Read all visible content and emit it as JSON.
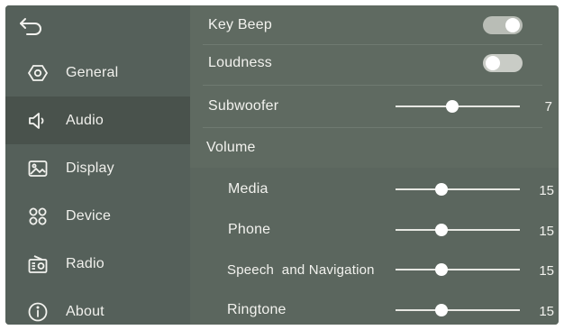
{
  "sidebar": {
    "back_icon": "back-arrow-icon",
    "items": [
      {
        "label": "General",
        "icon": "general-icon",
        "active": false
      },
      {
        "label": "Audio",
        "icon": "speaker-icon",
        "active": true
      },
      {
        "label": "Display",
        "icon": "picture-icon",
        "active": false
      },
      {
        "label": "Device",
        "icon": "device-icon",
        "active": false
      },
      {
        "label": "Radio",
        "icon": "radio-icon",
        "active": false
      },
      {
        "label": "About",
        "icon": "info-icon",
        "active": false
      }
    ]
  },
  "audio": {
    "key_beep": {
      "label": "Key Beep",
      "on": true
    },
    "loudness": {
      "label": "Loudness",
      "on": false
    },
    "subwoofer": {
      "label": "Subwoofer",
      "value": "7",
      "fraction": 0.46
    },
    "volume_heading": "Volume",
    "volume": [
      {
        "label": "Media",
        "value": "15",
        "fraction": 0.37
      },
      {
        "label": "Phone",
        "value": "15",
        "fraction": 0.37
      },
      {
        "label": "Speech  and Navigation",
        "value": "15",
        "fraction": 0.37
      },
      {
        "label": "Ringtone",
        "value": "15",
        "fraction": 0.37
      }
    ]
  },
  "colors": {
    "background": "#5f6a61",
    "sidebar": "#55605a",
    "active_item": "#49524c"
  }
}
